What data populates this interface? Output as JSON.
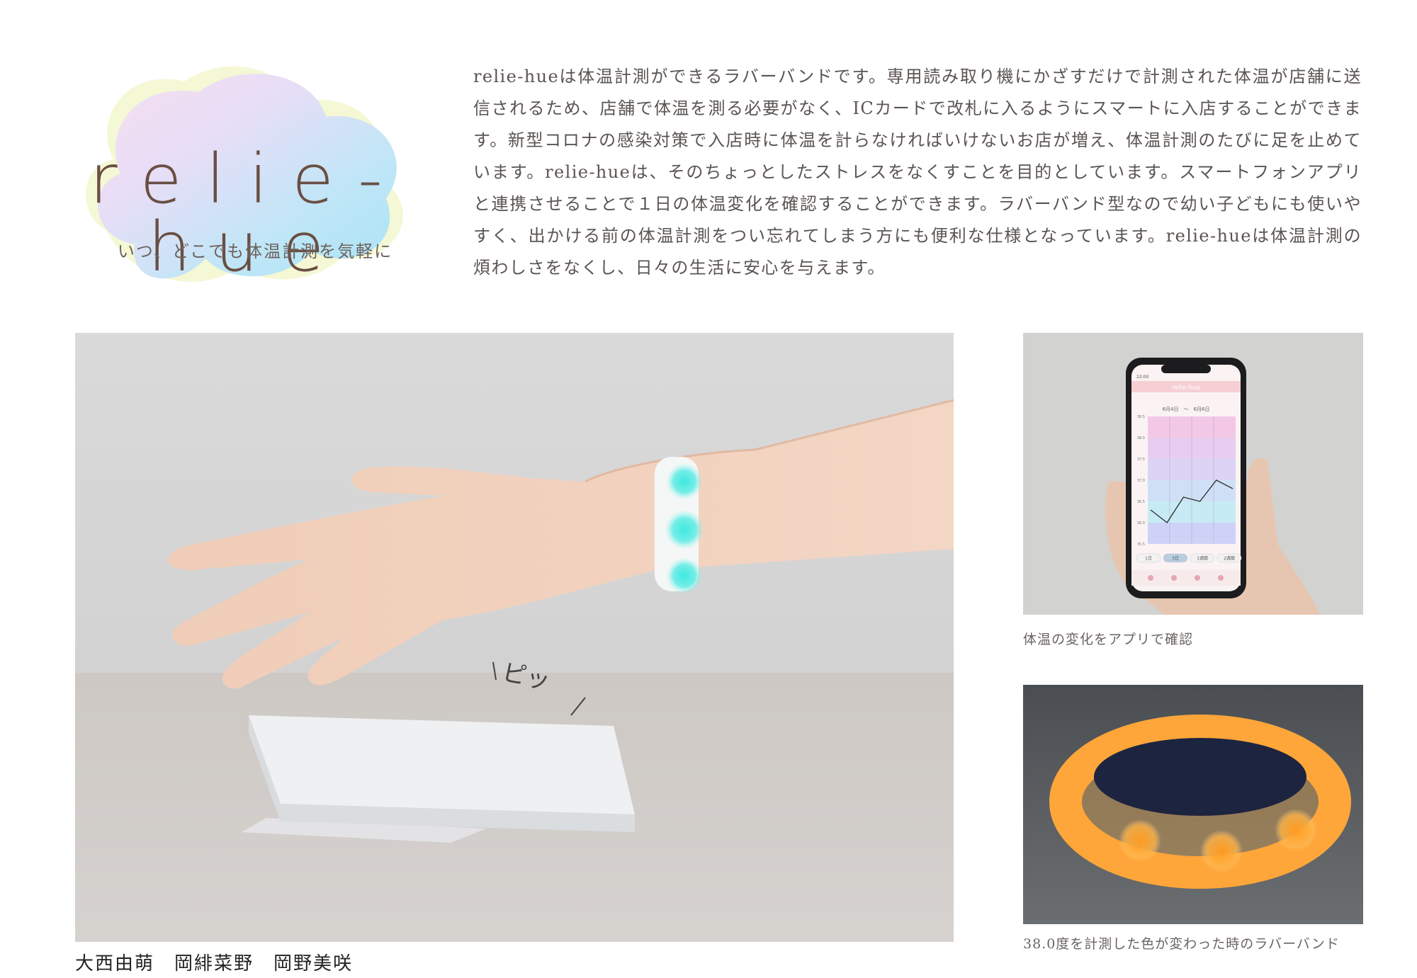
{
  "logo": {
    "title": "relie-hue",
    "tagline": "いつ、どこでも体温計測を気軽に"
  },
  "description": "relie-hueは体温計測ができるラバーバンドです。専用読み取り機にかざすだけで計測された体温が店舗に送信されるため、店舗で体温を測る必要がなく、ICカードで改札に入るようにスマートに入店することができます。新型コロナの感染対策で入店時に体温を計らなければいけないお店が増え、体温計測のたびに足を止めています。relie-hueは、そのちょっとしたストレスをなくすことを目的としています。スマートフォンアプリと連携させることで１日の体温変化を確認することができます。ラバーバンド型なので幼い子どもにも使いやすく、出かける前の体温計測をつい忘れてしまう方にも便利な仕様となっています。relie-hueは体温計測の煩わしさをなくし、日々の生活に安心を与えます。",
  "main_photo": {
    "sound_effect": "ピッ"
  },
  "credits": "大西由萌　岡緋菜野　岡野美咲",
  "app_photo": {
    "caption": "体温の変化をアプリで確認",
    "screen": {
      "time": "22:00",
      "app_title": "relie-hue",
      "date_range": "6月4日　〜　6月6日",
      "y_labels": [
        "38.5",
        "38.0",
        "37.5",
        "37.0",
        "36.5",
        "36.0",
        "35.5"
      ],
      "temperature_points": [
        36.3,
        36.0,
        36.6,
        36.5,
        37.0,
        36.8
      ],
      "range_buttons": [
        "1日",
        "3日",
        "1週間",
        "2週間"
      ],
      "selected_range": "3日"
    }
  },
  "band_photo": {
    "caption": "38.0度を計測した色が変わった時のラバーバンド"
  },
  "colors": {
    "logo_text": "#6a4e43",
    "band_glow_cyan": "#3fe9e0",
    "band_glow_orange": "#ff9a1f"
  }
}
